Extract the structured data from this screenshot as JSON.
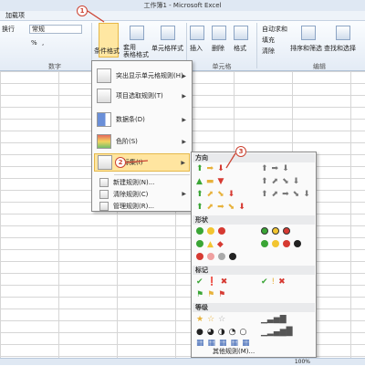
{
  "window": {
    "title": "工作簿1 - Microsoft Excel"
  },
  "tabs": {
    "addins": "加载项"
  },
  "ribbon": {
    "font_combo": "常规",
    "wrap_label": "换行",
    "percent_glyph": "%",
    "comma_glyph": ",",
    "number_group": "数字",
    "cond_format": "条件格式",
    "table_format": "套用\n表格格式",
    "cell_style": "单元格样式",
    "insert": "插入",
    "delete": "删除",
    "format": "格式",
    "cells_group": "单元格",
    "autosum": "自动求和",
    "fill": "填充",
    "clear": "清除",
    "sort_filter": "排序和筛选",
    "find_select": "查找和选择",
    "edit_group": "编辑"
  },
  "menu": {
    "items": [
      {
        "label": "突出显示单元格规则(H)",
        "arrow": "▶"
      },
      {
        "label": "项目选取规则(T)",
        "arrow": "▶"
      },
      {
        "label": "数据条(D)",
        "arrow": "▶"
      },
      {
        "label": "色阶(S)",
        "arrow": "▶"
      },
      {
        "label": "图标集(I)",
        "arrow": "▶"
      },
      {
        "label": "新建规则(N)..."
      },
      {
        "label": "清除规则(C)",
        "arrow": "▶"
      },
      {
        "label": "管理规则(R)..."
      }
    ]
  },
  "submenu": {
    "sections": [
      "方向",
      "形状",
      "标记",
      "等级"
    ],
    "more_rules": "其他规则(M)..."
  },
  "callouts": [
    "1",
    "2",
    "3"
  ],
  "status": {
    "zoom": "100%"
  }
}
